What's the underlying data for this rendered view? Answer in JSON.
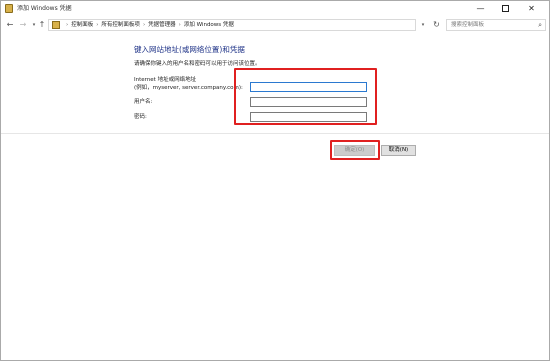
{
  "window": {
    "title": "添加 Windows 凭据",
    "minimize_glyph": "—",
    "close_glyph": "✕"
  },
  "nav": {
    "back_glyph": "←",
    "forward_glyph": "→",
    "recent_glyph": "▾",
    "up_glyph": "↑",
    "breadcrumbs": [
      "控制面板",
      "所有控制面板项",
      "凭据管理器",
      "添加 Windows 凭据"
    ],
    "separator": "›",
    "dropdown_glyph": "▾",
    "refresh_glyph": "↻",
    "search_placeholder": "搜索控制面板",
    "search_glyph": "⌕"
  },
  "form": {
    "heading": "键入网站地址(或网络位置)和凭据",
    "description": "请确保你键入的用户名和密码可以用于访问该位置。",
    "address_label_line1": "Internet 地址或网络地址",
    "address_label_line2": "(例如，myserver, server.company.com):",
    "address_value": "",
    "username_label": "用户名:",
    "username_value": "",
    "password_label": "密码:",
    "password_value": ""
  },
  "buttons": {
    "ok_label": "确定(O)",
    "cancel_label": "取消(N)"
  },
  "colors": {
    "heading": "#1e3287",
    "highlight": "#e02020",
    "focus_border": "#2b79d0"
  }
}
